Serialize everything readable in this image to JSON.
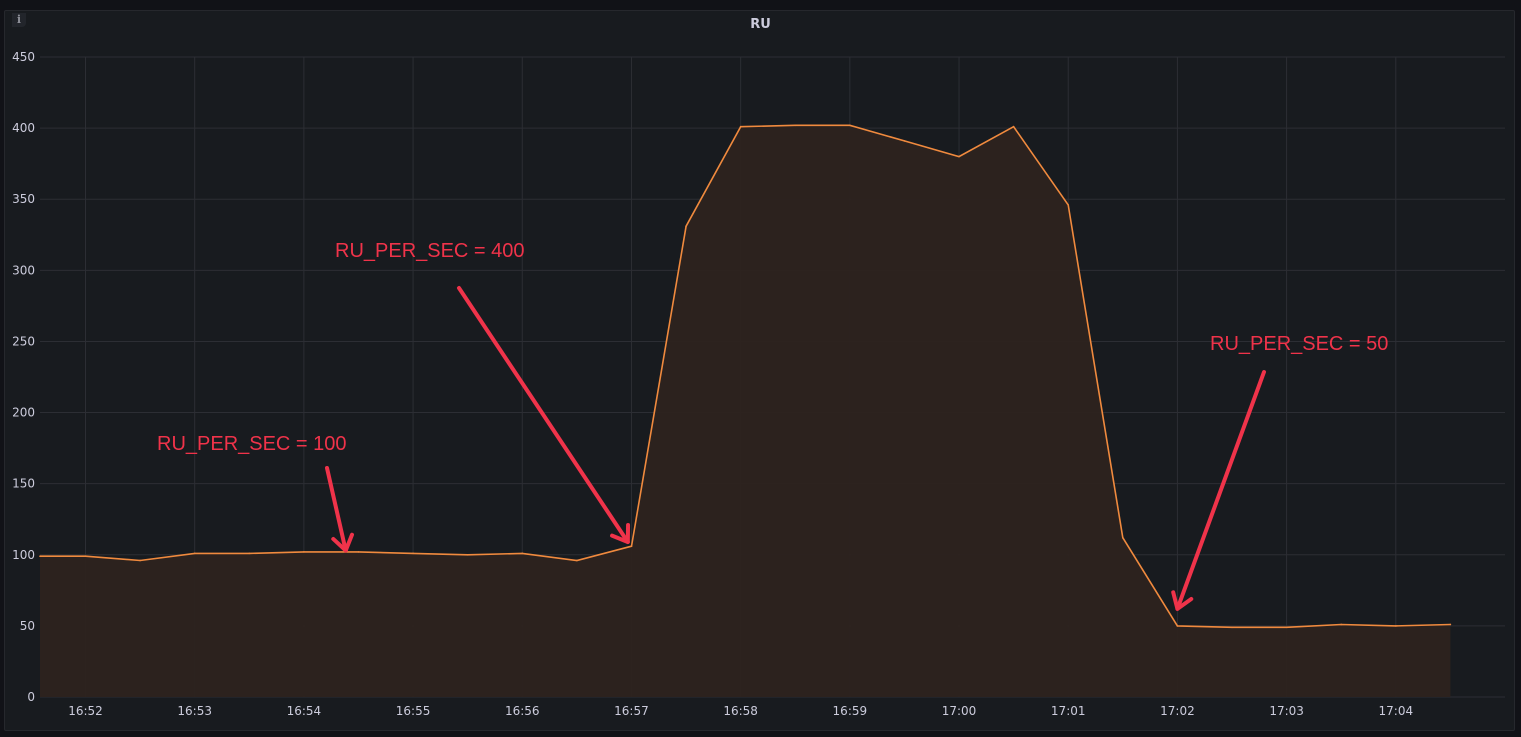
{
  "panel": {
    "title": "RU",
    "info_icon": "info-icon"
  },
  "colors": {
    "background": "#111217",
    "panel": "#181b1f",
    "grid": "#2c2e34",
    "series_line": "#f08a3e",
    "series_fill": "#2d231f",
    "annotation": "#f0334a"
  },
  "chart_data": {
    "type": "area",
    "title": "RU",
    "xlabel": "",
    "ylabel": "",
    "ylim": [
      0,
      450
    ],
    "y_ticks": [
      0,
      50,
      100,
      150,
      200,
      250,
      300,
      350,
      400,
      450
    ],
    "x_ticks": [
      "16:52",
      "16:53",
      "16:54",
      "16:55",
      "16:56",
      "16:57",
      "16:58",
      "16:59",
      "17:00",
      "17:01",
      "17:02",
      "17:03",
      "17:04"
    ],
    "x_range": [
      "16:51:35",
      "17:05:00"
    ],
    "grid": true,
    "legend": "none",
    "series": [
      {
        "x": [
          "16:51:35",
          "16:52:00",
          "16:52:30",
          "16:53:00",
          "16:53:30",
          "16:54:00",
          "16:54:30",
          "16:55:00",
          "16:55:30",
          "16:56:00",
          "16:56:30",
          "16:57:00",
          "16:57:30",
          "16:58:00",
          "16:58:30",
          "16:59:00",
          "16:59:30",
          "17:00:00",
          "17:00:30",
          "17:01:00",
          "17:01:30",
          "17:02:00",
          "17:02:30",
          "17:03:00",
          "17:03:30",
          "17:04:00",
          "17:04:30"
        ],
        "values": [
          99,
          99,
          96,
          101,
          101,
          102,
          102,
          101,
          100,
          101,
          96,
          106,
          331,
          401,
          402,
          402,
          391,
          380,
          401,
          346,
          112,
          50,
          49,
          49,
          51,
          50,
          51
        ]
      }
    ],
    "annotations": [
      {
        "text": "RU_PER_SEC = 100",
        "at_x": "16:54:23",
        "at_y": 103
      },
      {
        "text": "RU_PER_SEC = 400",
        "at_x": "16:56:58",
        "at_y": 109
      },
      {
        "text": "RU_PER_SEC = 50",
        "at_x": "17:02:00",
        "at_y": 62
      }
    ]
  }
}
